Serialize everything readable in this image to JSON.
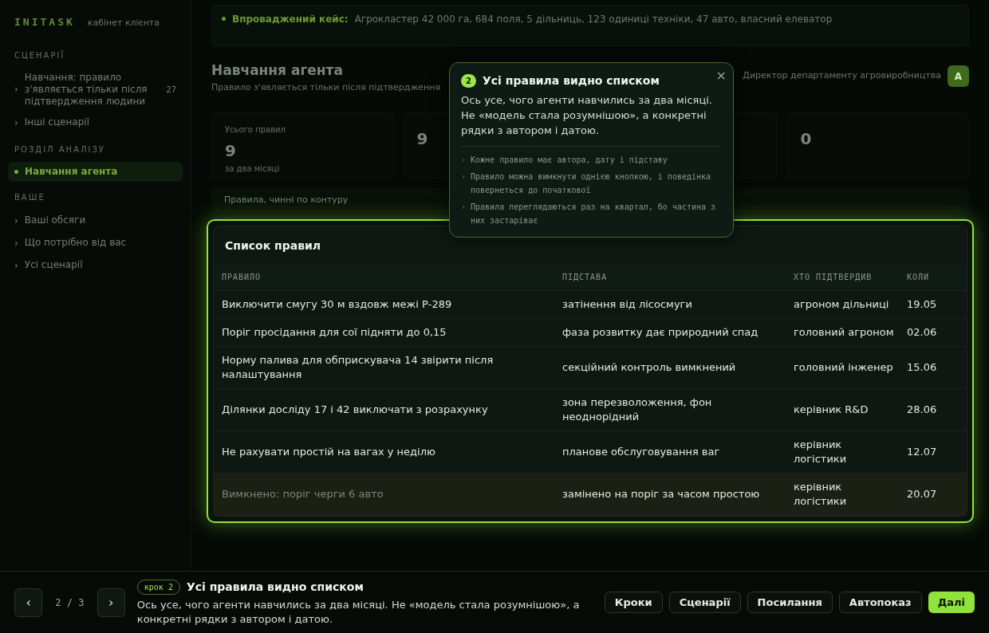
{
  "sidebar": {
    "brand": "INITASK",
    "subtitle": "кабінет клієнта",
    "marker": "›",
    "sections": [
      {
        "heading": "СЦЕНАРІЇ",
        "items": [
          {
            "label": "Навчання: правило з'являється тільки після підтвердження людини",
            "count": "27",
            "selected": false
          },
          {
            "label": "Інші сценарії",
            "selected": false
          }
        ]
      },
      {
        "heading": "РОЗДІЛ АНАЛІЗУ",
        "items": [
          {
            "label": "Навчання агента",
            "selected": true
          }
        ]
      },
      {
        "heading": "ВАШЕ",
        "items": [
          {
            "label": "Ваші обсяги",
            "selected": false
          },
          {
            "label": "Що потрібно від вас",
            "selected": false
          },
          {
            "label": "Усі сценарії",
            "selected": false
          }
        ]
      }
    ]
  },
  "banner": {
    "label": "Впроваджений кейс:",
    "text": "Агрокластер 42 000 га, 684 поля, 5 дільниць, 123 одиниці техніки, 47 авто, власний елеватор"
  },
  "header": {
    "title": "Навчання агента",
    "subtitle": "Правило з'являється тільки після підтвердження",
    "user": "Директор департаменту агровиробництва",
    "avatar": "А"
  },
  "stats": [
    {
      "kind": "stat",
      "label": "Усього правил",
      "value": "9",
      "note": "за два місяці"
    },
    {
      "kind": "stat",
      "value": "9"
    },
    {
      "kind": "covered"
    },
    {
      "kind": "stat",
      "value": "0"
    }
  ],
  "filter_row": {
    "text": "Правила, чинні по контуру"
  },
  "table": {
    "title": "Список правил",
    "columns": [
      "ПРАВИЛО",
      "ПІДСТАВА",
      "ХТО ПІДТВЕРДИВ",
      "КОЛИ"
    ],
    "rows": [
      {
        "cells": [
          "Виключити смугу 30 м вздовж межі Р-289",
          "затінення від лісосмуги",
          "агроном дільниці",
          "19.05"
        ],
        "disabled": false
      },
      {
        "cells": [
          "Поріг просідання для сої підняти до 0,15",
          "фаза розвитку дає природний спад",
          "головний агроном",
          "02.06"
        ],
        "disabled": false
      },
      {
        "cells": [
          "Норму палива для обприскувача 14 звірити після налаштування",
          "секційний контроль вимкнений",
          "головний інженер",
          "15.06"
        ],
        "disabled": false
      },
      {
        "cells": [
          "Ділянки досліду 17 і 42 виключати з розрахунку",
          "зона перезволоження, фон неоднорідний",
          "керівник R&D",
          "28.06"
        ],
        "disabled": false
      },
      {
        "cells": [
          "Не рахувати простій на вагах у неділю",
          "планове обслуговування ваг",
          "керівник логістики",
          "12.07"
        ],
        "disabled": false
      },
      {
        "cells": [
          "Вимкнено: поріг черги 6 авто",
          "замінено на поріг за часом простою",
          "керівник логістики",
          "20.07"
        ],
        "disabled": true
      }
    ]
  },
  "tooltip": {
    "step": "2",
    "title": "Усі правила видно списком",
    "close": "×",
    "body": "Ось усе, чого агенти навчились за два місяці. Не «модель стала розумнішою», а конкретні рядки з автором і датою.",
    "marker": "›",
    "bullets": [
      "Кожне правило має автора, дату і підставу",
      "Правило можна вимкнути однією кнопкою, і поведінка повернеться до початкової",
      "Правила переглядаються раз на квартал, бо частина з них застаріває"
    ]
  },
  "tour_bar": {
    "prev": "‹",
    "counter": "2 / 3",
    "next": "›",
    "step_badge": "крок 2",
    "title": "Усі правила видно списком",
    "body": "Ось усе, чого агенти навчились за два місяці. Не «модель стала розумнішою», а конкретні рядки з автором і датою.",
    "buttons": [
      {
        "label": "Кроки",
        "primary": false
      },
      {
        "label": "Сценарії",
        "primary": false
      },
      {
        "label": "Посилання",
        "primary": false
      },
      {
        "label": "Автопоказ",
        "primary": false
      },
      {
        "label": "Далі",
        "primary": true
      }
    ]
  }
}
